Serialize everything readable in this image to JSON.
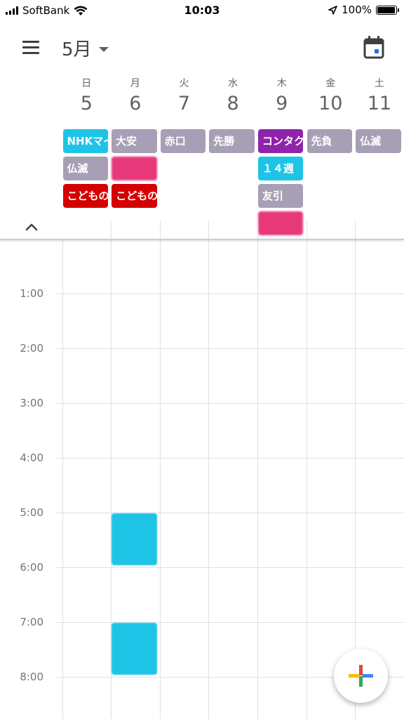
{
  "status_bar": {
    "carrier": "SoftBank",
    "time": "10:03",
    "battery": "100%",
    "battery_level": 1.0
  },
  "app_bar": {
    "month": "5月",
    "menu_icon": "hamburger-menu-icon",
    "today_icon": "calendar-today-icon"
  },
  "days": [
    {
      "weekday": "日",
      "date": "5"
    },
    {
      "weekday": "月",
      "date": "6"
    },
    {
      "weekday": "火",
      "date": "7"
    },
    {
      "weekday": "水",
      "date": "8"
    },
    {
      "weekday": "木",
      "date": "9"
    },
    {
      "weekday": "金",
      "date": "10"
    },
    {
      "weekday": "土",
      "date": "11"
    }
  ],
  "all_day_events": [
    {
      "day": 0,
      "row": 0,
      "title": "NHKマイ",
      "color": "#1ec4e6"
    },
    {
      "day": 0,
      "row": 1,
      "title": "仏滅",
      "color": "#a79fb5"
    },
    {
      "day": 0,
      "row": 2,
      "title": "こどもの",
      "color": "#d50000"
    },
    {
      "day": 1,
      "row": 0,
      "title": "大安",
      "color": "#a79fb5"
    },
    {
      "day": 1,
      "row": 1,
      "title": "",
      "color": "#e7387a",
      "obscured": true
    },
    {
      "day": 1,
      "row": 2,
      "title": "こどもの",
      "color": "#d50000"
    },
    {
      "day": 2,
      "row": 0,
      "title": "赤口",
      "color": "#a79fb5"
    },
    {
      "day": 3,
      "row": 0,
      "title": "先勝",
      "color": "#a79fb5"
    },
    {
      "day": 4,
      "row": 0,
      "title": "コンタク",
      "color": "#8e24aa"
    },
    {
      "day": 4,
      "row": 1,
      "title": "１４週",
      "color": "#1ec4e6"
    },
    {
      "day": 4,
      "row": 2,
      "title": "友引",
      "color": "#a79fb5"
    },
    {
      "day": 4,
      "row": 3,
      "title": "",
      "color": "#e7387a",
      "obscured": true
    },
    {
      "day": 5,
      "row": 0,
      "title": "先負",
      "color": "#a79fb5"
    },
    {
      "day": 6,
      "row": 0,
      "title": "仏滅",
      "color": "#a79fb5"
    }
  ],
  "hours": [
    "1:00",
    "2:00",
    "3:00",
    "4:00",
    "5:00",
    "6:00",
    "7:00",
    "8:00"
  ],
  "timed_events": [
    {
      "day": 1,
      "start": 5.0,
      "end": 6.0,
      "color": "#1ec4e6"
    },
    {
      "day": 1,
      "start": 7.0,
      "end": 8.0,
      "color": "#1ec4e6"
    }
  ],
  "fab": {
    "icon": "add-plus-icon",
    "colors": [
      "#ea4335",
      "#4285f4",
      "#34a853",
      "#fbbc05"
    ]
  }
}
